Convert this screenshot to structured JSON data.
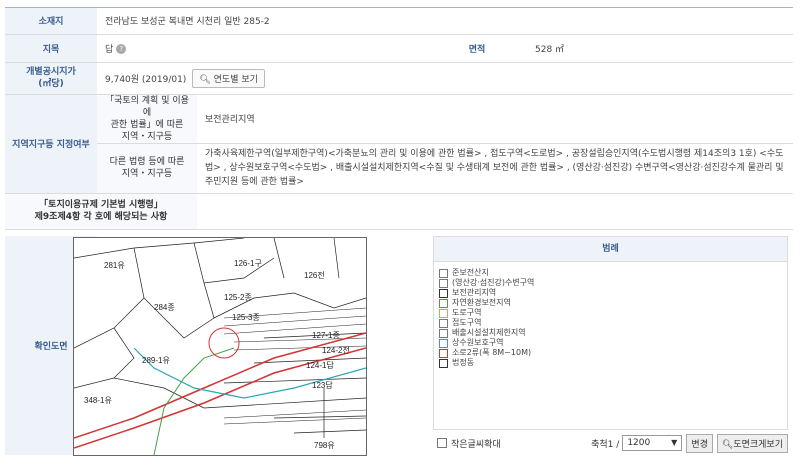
{
  "rows": {
    "address": {
      "label": "소재지",
      "value": "전라남도 보성군 복내면 시천리 일반 285-2"
    },
    "jimok": {
      "label": "지목",
      "value": "답"
    },
    "area": {
      "label": "면적",
      "value": "528 ㎡"
    },
    "price": {
      "label": "개별공시지가\n(㎡당)",
      "value": "9,740원 (2019/01)",
      "button": "연도별 보기"
    },
    "zone": {
      "label": "지역지구등 지정여부",
      "sub1_label": "「국토의 계획 및 이용에\n관한 법률」에 따른\n지역・지구등",
      "sub1_value": "보전관리지역",
      "sub2_label": "다른 법령 등에 따른\n지역・지구등",
      "sub2_value": "가축사육제한구역(일부제한구역)<가축분뇨의 관리 및 이용에 관한 법률> , 접도구역<도로법> , 공장설립승인지역(수도법시행령 제14조의3 1호) <수도법> , 상수원보호구역<수도법> , 배출시설설치제한지역<수질 및 수생태계 보전에 관한 법률> , (영산강·섬진강) 수변구역<영산강·섬진강수계 물관리 및 주민지원 등에 관한 법률>"
    },
    "enforce": {
      "label": "「토지이용규제 기본법 시행령」\n제9조제4항 각 호에 해당되는 사항",
      "value": ""
    }
  },
  "map": {
    "label": "확인도면",
    "parcels": [
      "281유",
      "126-1구",
      "126전",
      "284종",
      "125-2종",
      "125-3종",
      "127-1종",
      "124-2전",
      "289-1유",
      "124-1답",
      "123답",
      "348-1유",
      "798유"
    ]
  },
  "legend": {
    "title": "범례",
    "items": [
      {
        "label": "준보전산지",
        "color": "#777777"
      },
      {
        "label": "(영산강·섬진강)수변구역",
        "color": "#777777"
      },
      {
        "label": "보전관리지역",
        "color": "#333333"
      },
      {
        "label": "자연환경보전지역",
        "color": "#4a9e4a"
      },
      {
        "label": "도로구역",
        "color": "#e0a040"
      },
      {
        "label": "접도구역",
        "color": "#777777"
      },
      {
        "label": "배출시설설치제한지역",
        "color": "#777777"
      },
      {
        "label": "상수원보호구역",
        "color": "#2aa6b0"
      },
      {
        "label": "소로2류(폭 8M~10M)",
        "color": "#d33333"
      },
      {
        "label": "법정동",
        "color": "#333333"
      }
    ],
    "enlarge_label": "작은글씨확대",
    "scale_label": "축척1 /",
    "scale_value": "1200",
    "change_button": "변경",
    "print_button": "도면크게보기"
  }
}
